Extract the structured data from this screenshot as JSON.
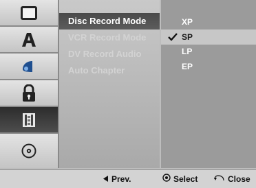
{
  "sidebar": {
    "items": [
      {
        "icon": "tv-screen-icon"
      },
      {
        "icon": "language-letter-a-icon"
      },
      {
        "icon": "audio-speaker-icon"
      },
      {
        "icon": "lock-icon"
      },
      {
        "icon": "film-record-icon",
        "active": true
      },
      {
        "icon": "disc-icon"
      }
    ]
  },
  "menu": {
    "items": [
      {
        "label": "Disc Record Mode",
        "active": true
      },
      {
        "label": "VCR Record Mode"
      },
      {
        "label": "DV Record Audio"
      },
      {
        "label": "Auto Chapter"
      }
    ]
  },
  "options": {
    "items": [
      {
        "label": "XP"
      },
      {
        "label": "SP",
        "selected": true
      },
      {
        "label": "LP"
      },
      {
        "label": "EP"
      }
    ]
  },
  "bottom": {
    "prev_label": "Prev.",
    "select_label": "Select",
    "close_label": "Close"
  },
  "colors": {
    "active_menu": "#4a4a4a",
    "selected_option": "#c7c7c7",
    "panel_bg": "#9b9b9b"
  }
}
